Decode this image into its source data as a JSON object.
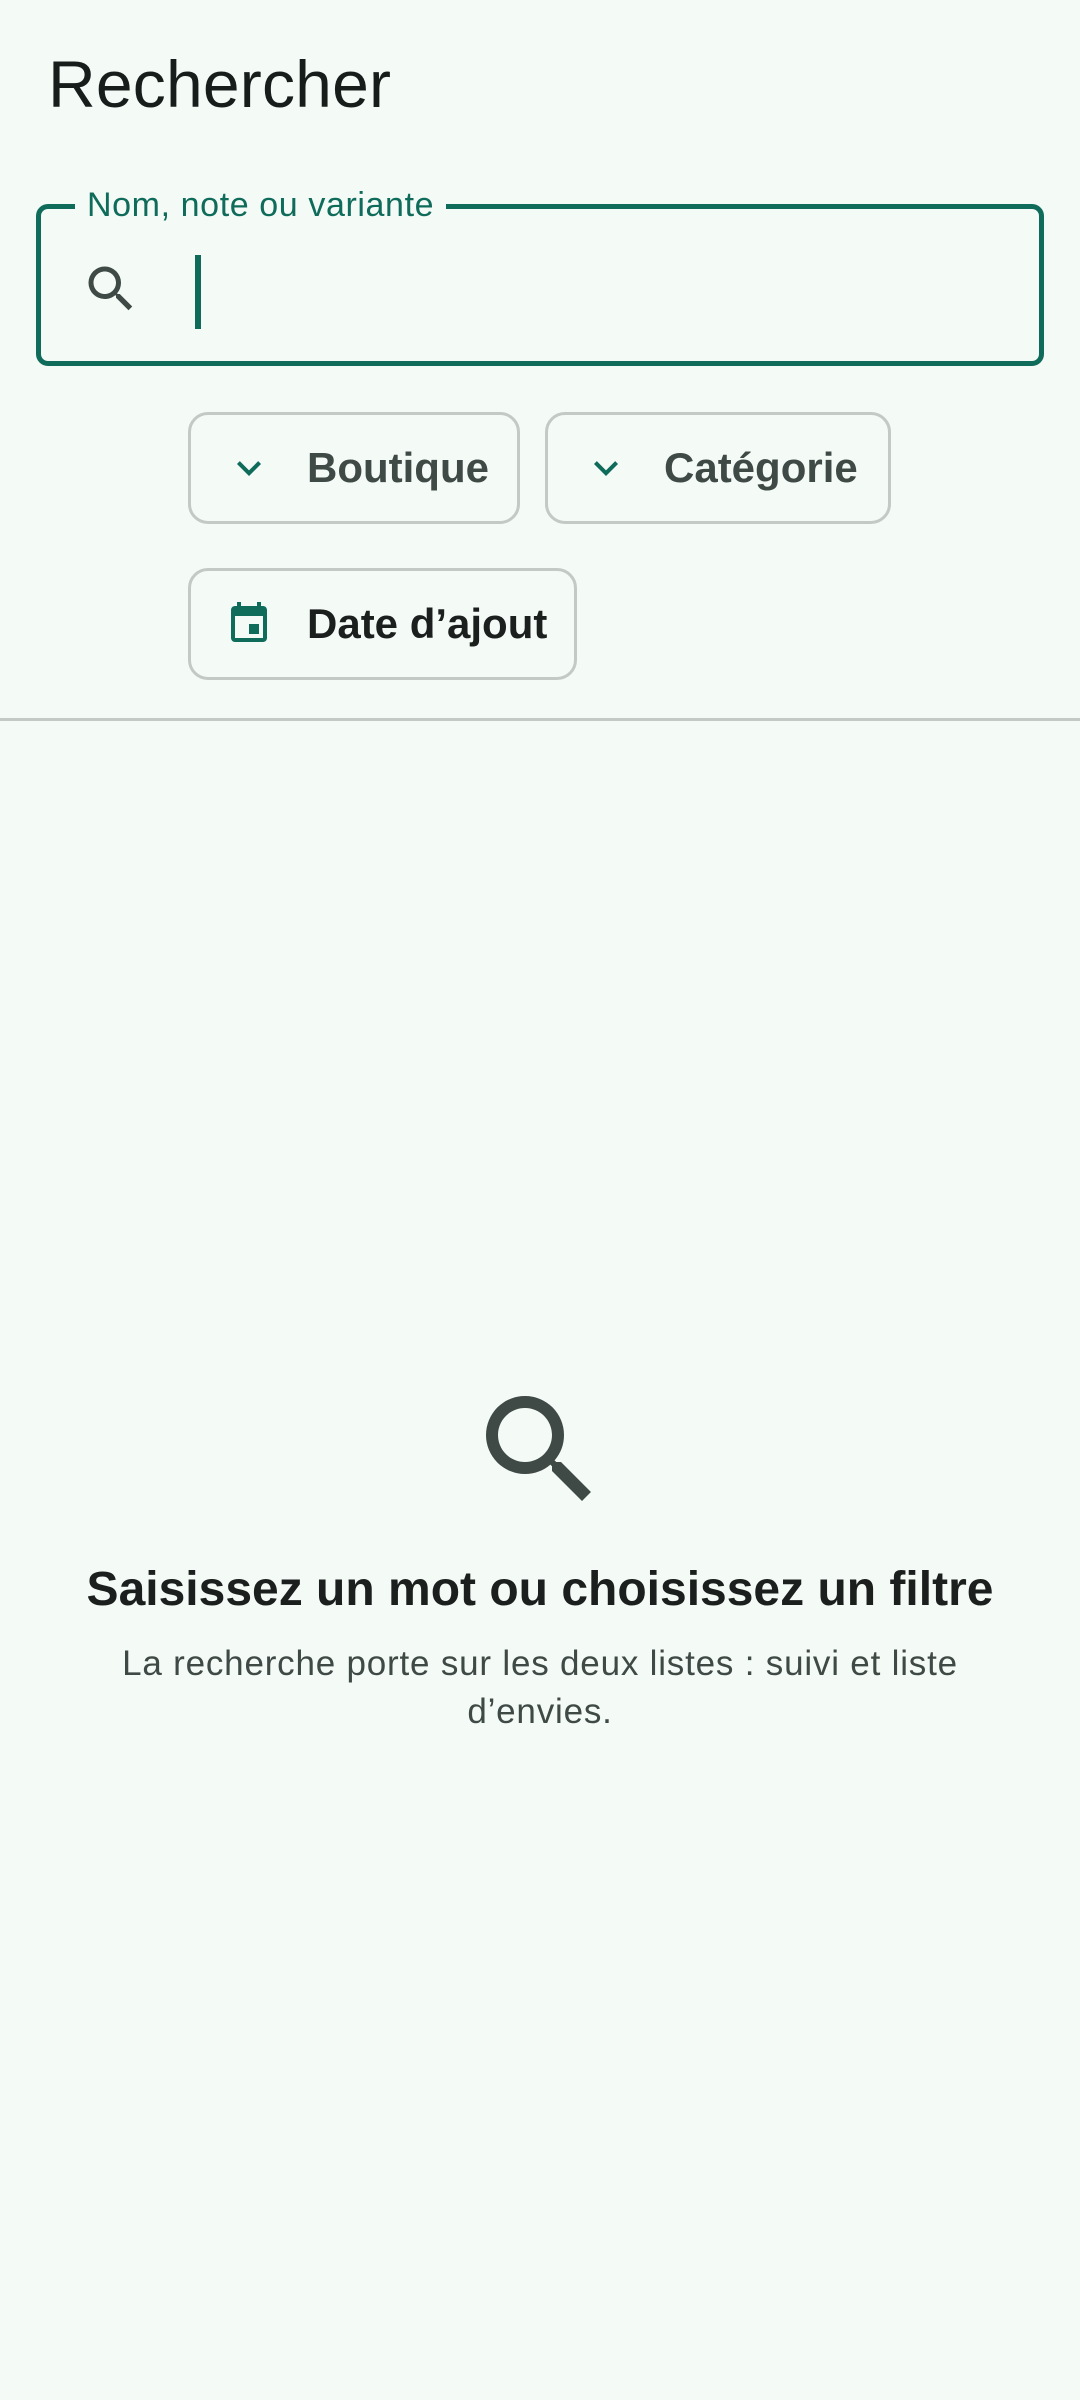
{
  "header": {
    "title": "Rechercher"
  },
  "search": {
    "label": "Nom, note ou variante",
    "value": "",
    "icon": "search-icon"
  },
  "filters": [
    {
      "label": "Boutique",
      "icon": "chevron-down-icon"
    },
    {
      "label": "Catégorie",
      "icon": "chevron-down-icon"
    },
    {
      "label": "Date d’ajout",
      "icon": "calendar-icon"
    }
  ],
  "empty_state": {
    "icon": "search-icon",
    "title": "Saisissez un mot ou choisissez un filtre",
    "subtitle": "La recherche porte sur les deux listes : suivi et liste d’envies."
  },
  "colors": {
    "background": "#f4faf6",
    "accent": "#0f6b5a",
    "outline": "#c3c9c5",
    "text_primary": "#1b1f1d",
    "text_secondary": "#3f4945"
  }
}
